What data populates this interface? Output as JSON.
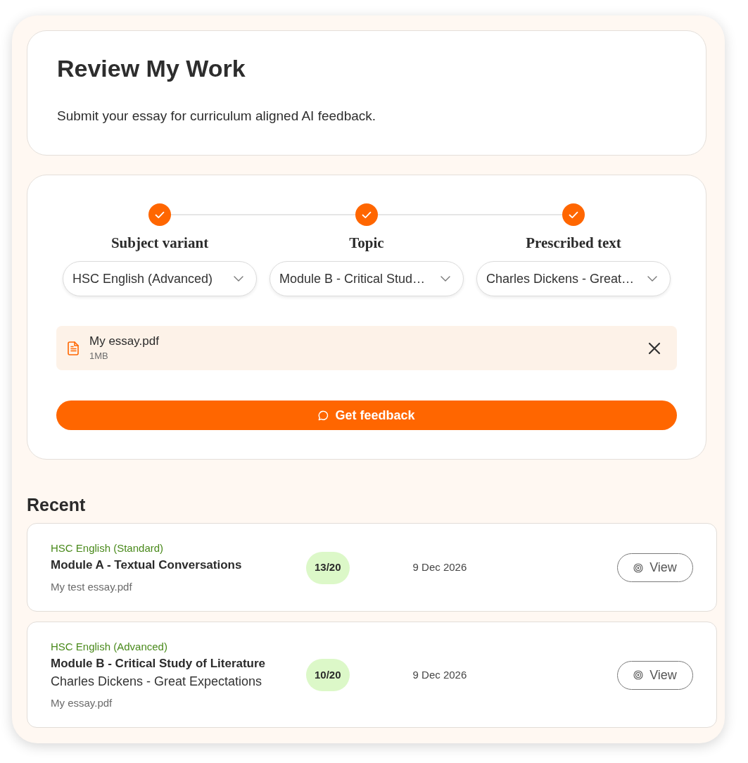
{
  "header": {
    "title": "Review My Work",
    "subtitle": "Submit your essay for curriculum aligned AI feedback."
  },
  "steps": [
    {
      "label": "Subject variant",
      "completed": true,
      "value": "HSC English (Advanced)"
    },
    {
      "label": "Topic",
      "completed": true,
      "value": "Module B - Critical Stud…"
    },
    {
      "label": "Prescribed text",
      "completed": true,
      "value": "Charles Dickens - Great…"
    }
  ],
  "upload": {
    "file_name": "My essay.pdf",
    "file_size": "1MB"
  },
  "submit_button": {
    "label": "Get feedback"
  },
  "recent": {
    "title": "Recent",
    "items": [
      {
        "subject": "HSC English (Standard)",
        "module": "Module A - Textual Conversations",
        "file_name": "My test essay.pdf",
        "score": "13/20",
        "date": "9 Dec 2026",
        "action": "View"
      },
      {
        "subject": "HSC English (Advanced)",
        "module": "Module B - Critical Study of Literature",
        "prescribed_text": "Charles Dickens - Great Expectations",
        "file_name": "My essay.pdf",
        "score": "10/20",
        "date": "9 Dec 2026",
        "action": "View"
      }
    ]
  }
}
